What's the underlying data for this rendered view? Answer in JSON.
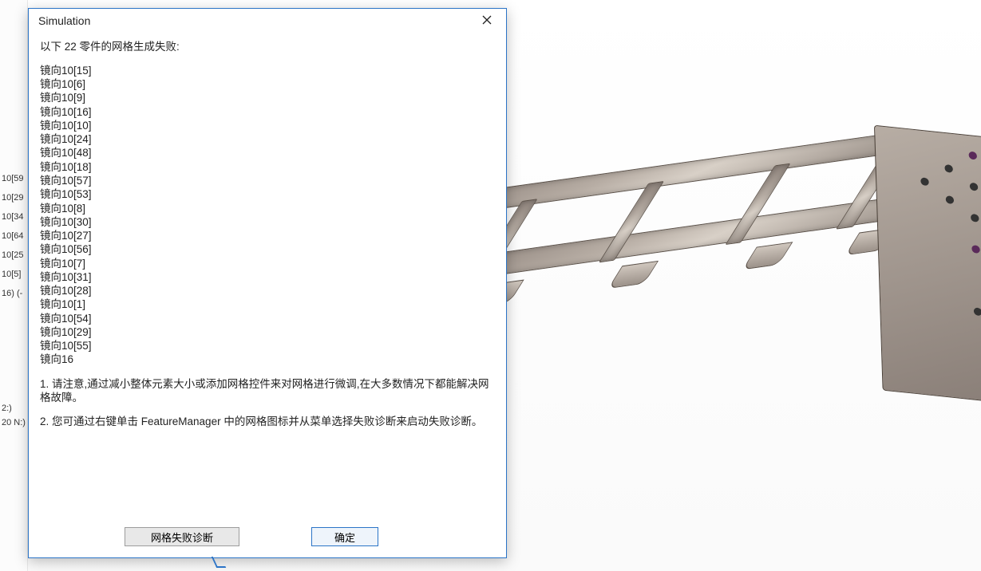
{
  "dialog": {
    "title": "Simulation",
    "heading": "以下 22 零件的网格生成失败:",
    "failed_items": [
      "镜向10[15]",
      "镜向10[6]",
      "镜向10[9]",
      "镜向10[16]",
      "镜向10[10]",
      "镜向10[24]",
      "镜向10[48]",
      "镜向10[18]",
      "镜向10[57]",
      "镜向10[53]",
      "镜向10[8]",
      "镜向10[30]",
      "镜向10[27]",
      "镜向10[56]",
      "镜向10[7]",
      "镜向10[31]",
      "镜向10[28]",
      "镜向10[1]",
      "镜向10[54]",
      "镜向10[29]",
      "镜向10[55]",
      "镜向16"
    ],
    "note1": "1. 请注意,通过减小整体元素大小或添加网格控件来对网格进行微调,在大多数情况下都能解决网格故障。",
    "note2": "2. 您可通过右键单击 FeatureManager 中的网格图标并从菜单选择失败诊断来启动失败诊断。",
    "buttons": {
      "diagnose": "网格失败诊断",
      "ok": "确定"
    }
  },
  "background_rows": [
    "10[59",
    "10[29",
    "10[34",
    "10[64",
    "10[25",
    "10[5]",
    "16) (-"
  ],
  "background_lower": [
    "2:)",
    "20 N:)"
  ]
}
